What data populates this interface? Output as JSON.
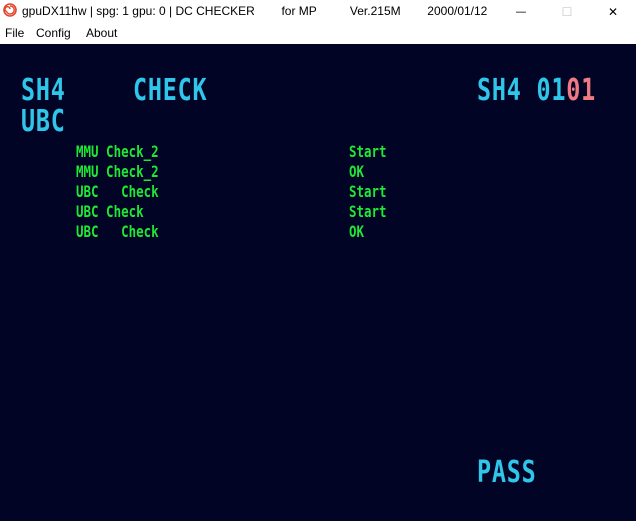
{
  "window": {
    "title": "gpuDX11hw | spg: 1 gpu: 0 | DC CHECKER        for MP          Ver.215M        2000/01/12",
    "controls": {
      "minimize": "—",
      "maximize": "☐",
      "close": "✕"
    }
  },
  "menu": {
    "items": [
      "File",
      "Config",
      "About"
    ]
  },
  "screen": {
    "header_left": "SH4",
    "header_title": "CHECK",
    "header_right_prefix": "SH4 01",
    "header_right_suffix": "01",
    "section": "UBC",
    "log": [
      {
        "test": "MMU Check_2",
        "status": "Start"
      },
      {
        "test": "MMU Check_2",
        "status": "OK"
      },
      {
        "test": "UBC   Check",
        "status": "Start"
      },
      {
        "test": "UBC Check",
        "status": "Start"
      },
      {
        "test": "UBC   Check",
        "status": "OK"
      }
    ],
    "result": "PASS"
  },
  "colors": {
    "background": "#020426",
    "cyan_text": "#2fc6ea",
    "green_text": "#1ee834",
    "red_text": "#f07a82"
  }
}
